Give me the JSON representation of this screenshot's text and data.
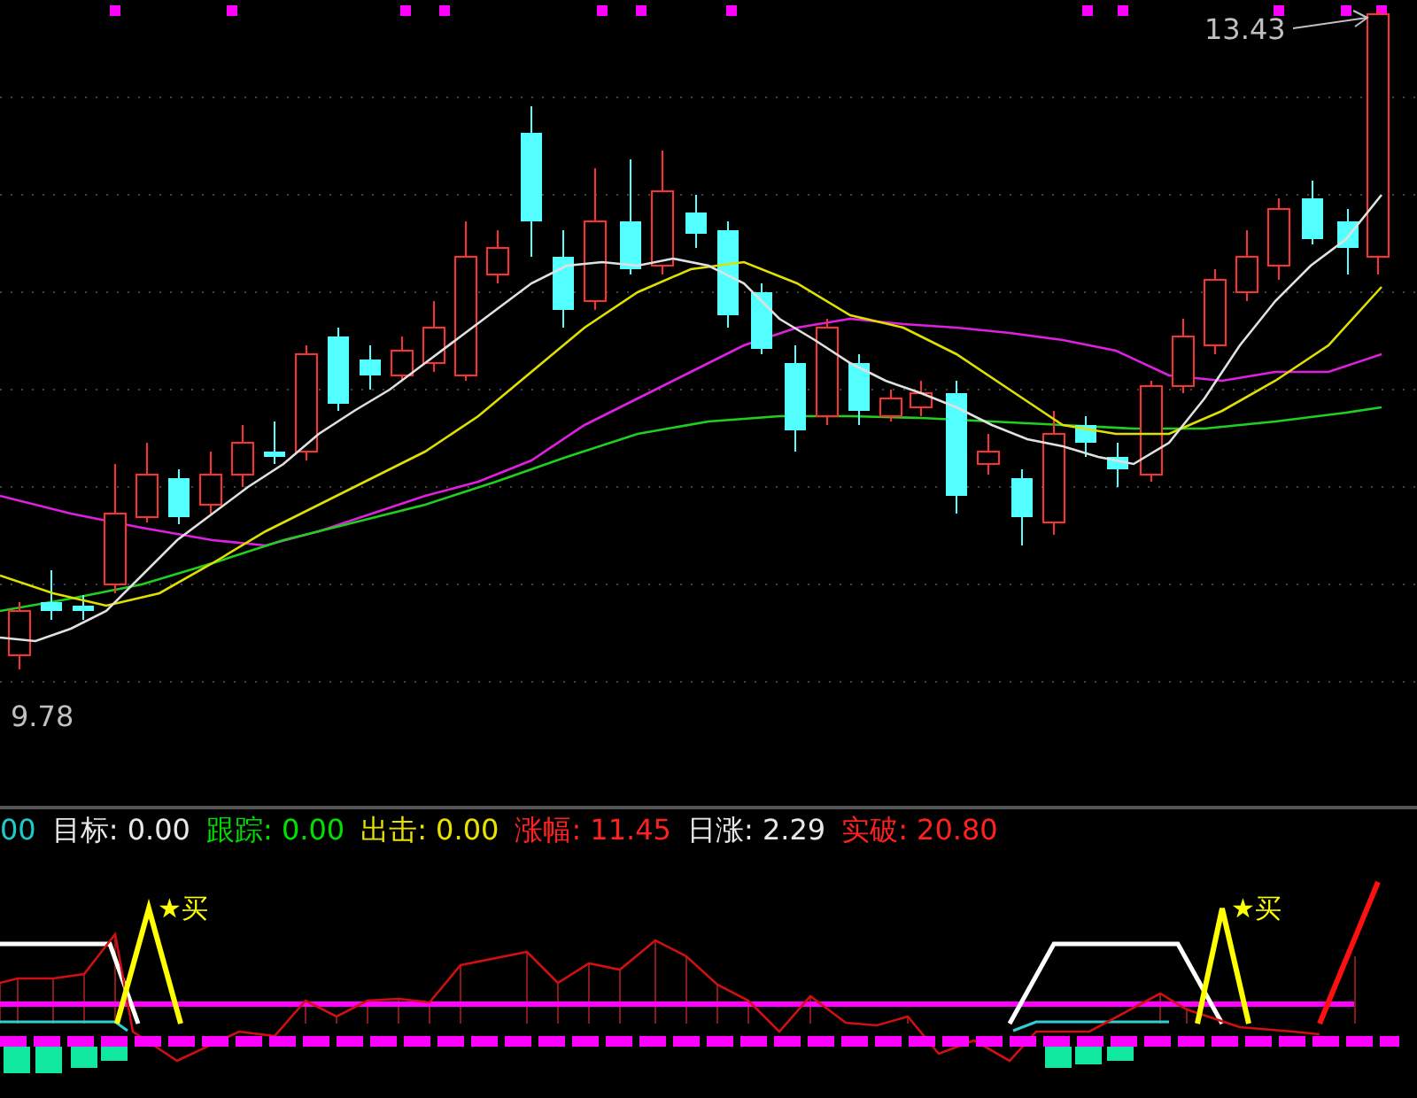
{
  "main_chart": {
    "high_label": "13.43",
    "low_label": "9.78"
  },
  "indicator_legend": [
    {
      "text": "00",
      "color": "#20c8c8"
    },
    {
      "text": "目标: 0.00",
      "color": "#e8e8e8"
    },
    {
      "text": "跟踪: 0.00",
      "color": "#00e000"
    },
    {
      "text": "出击: 0.00",
      "color": "#e8e000"
    },
    {
      "text": "涨幅: 11.45",
      "color": "#ff2020"
    },
    {
      "text": "日涨: 2.29",
      "color": "#e8e8e8"
    },
    {
      "text": "实破: 20.80",
      "color": "#ff2020"
    }
  ],
  "indicator_chart": {
    "signals": [
      {
        "label": "★买"
      },
      {
        "label": "★买"
      }
    ]
  }
}
